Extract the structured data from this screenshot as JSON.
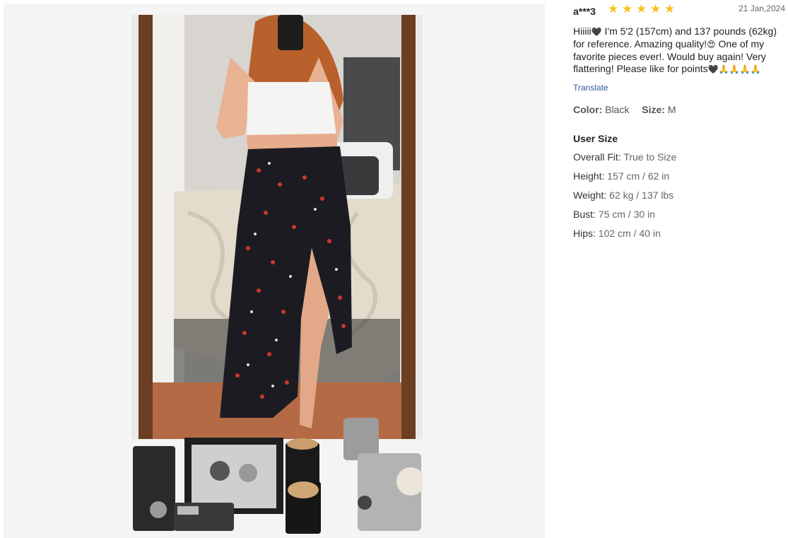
{
  "review": {
    "reviewer": "a***3",
    "rating": 5,
    "date": "21 Jan,2024",
    "text_1": "Hiiiii",
    "text_2": " I'm 5'2 (157cm) and 137 pounds (62kg) for reference. Amazing quality!",
    "text_3": " One of my favorite pieces ever!. Would buy again! Very flattering! Please like for points",
    "translate_label": "Translate",
    "color_label": "Color:",
    "color_value": "Black",
    "size_label": "Size:",
    "size_value": "M"
  },
  "user_size": {
    "title": "User Size",
    "rows": [
      {
        "label": "Overall Fit:",
        "value": "True to Size"
      },
      {
        "label": "Height:",
        "value": "157 cm / 62 in"
      },
      {
        "label": "Weight:",
        "value": "62 kg / 137 lbs"
      },
      {
        "label": "Bust:",
        "value": "75 cm / 30 in"
      },
      {
        "label": "Hips:",
        "value": "102 cm / 40 in"
      }
    ]
  },
  "icons": {
    "star": "star-icon",
    "heart": "black-heart-emoji",
    "heart_eyes": "heart-eyes-emoji",
    "pray": "praying-hands-emoji"
  }
}
